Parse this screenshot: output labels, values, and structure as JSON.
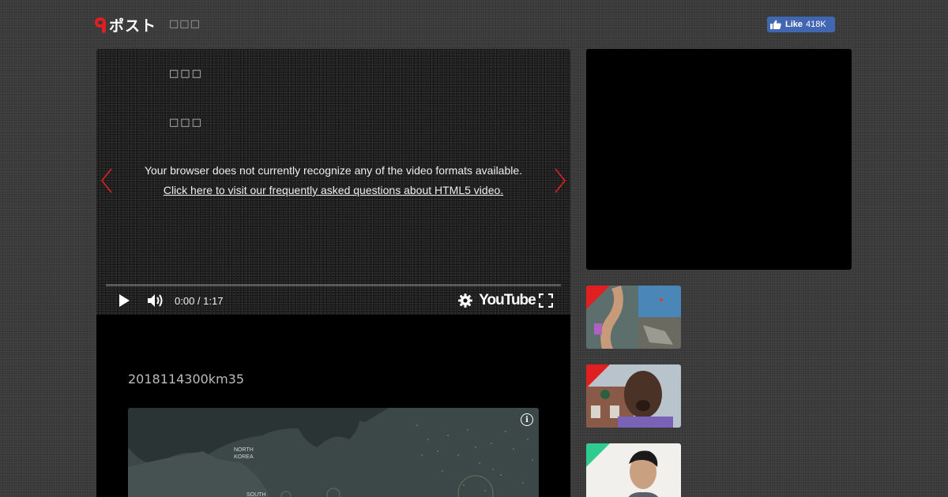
{
  "header": {
    "brand": "ポスト",
    "sub": "□□□",
    "fb_like": {
      "label": "Like",
      "count": "418K"
    }
  },
  "video": {
    "line1": "□□□",
    "line2": "□□□",
    "message": "Your browser does not currently recognize any of the video formats available.",
    "link": "Click here to visit our frequently asked questions about HTML5 video.",
    "time": "0:00 / 1:17",
    "logo": "YouTube",
    "arrow_color": "#e02020"
  },
  "article": {
    "text": "2018114300km35",
    "map": {
      "labels": [
        "NORTH\nKOREA",
        "SOUTH"
      ],
      "info_icon": "info-icon"
    }
  },
  "sidebar": {
    "thumbnails": [
      {
        "corner_color": "#e02020",
        "name": "thumbnail-map-news"
      },
      {
        "corner_color": "#e02020",
        "name": "thumbnail-man-shouting"
      },
      {
        "corner_color": "#2ecc8f",
        "name": "thumbnail-man-talking"
      }
    ]
  }
}
